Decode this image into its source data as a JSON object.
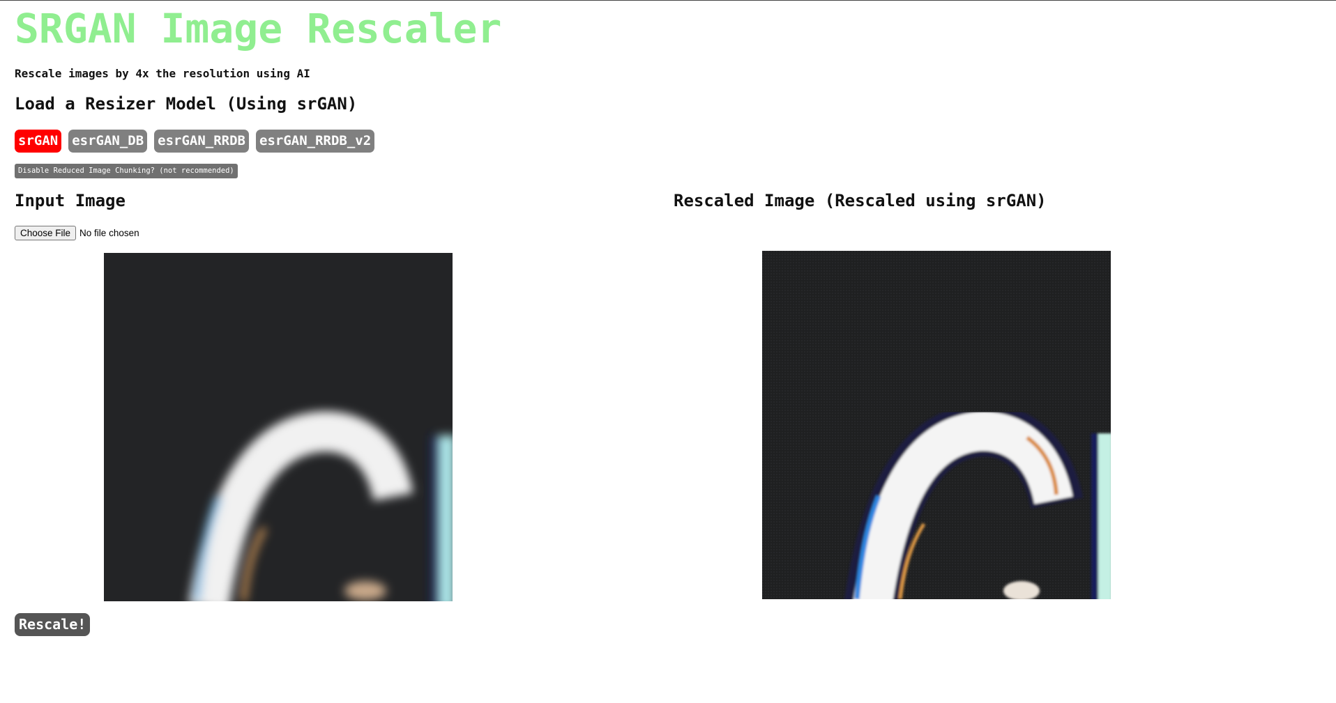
{
  "title": "SRGAN Image Rescaler",
  "subtitle": "Rescale images by 4x the resolution using AI",
  "model_section": {
    "heading": "Load a Resizer Model (Using srGAN)",
    "models": [
      {
        "label": "srGAN",
        "active": true
      },
      {
        "label": "esrGAN_DB",
        "active": false
      },
      {
        "label": "esrGAN_RRDB",
        "active": false
      },
      {
        "label": "esrGAN_RRDB_v2",
        "active": false
      }
    ],
    "chunking_label": "Disable Reduced Image Chunking? (not recommended)"
  },
  "input": {
    "heading": "Input Image",
    "choose_file_label": "Choose File",
    "file_status": "No file chosen"
  },
  "output": {
    "heading": "Rescaled Image (Rescaled using srGAN)"
  },
  "rescale_label": "Rescale!",
  "colors": {
    "title": "#90ee90",
    "active_model": "#ff0000",
    "inactive_model": "#808080",
    "image_background": "#232426"
  }
}
